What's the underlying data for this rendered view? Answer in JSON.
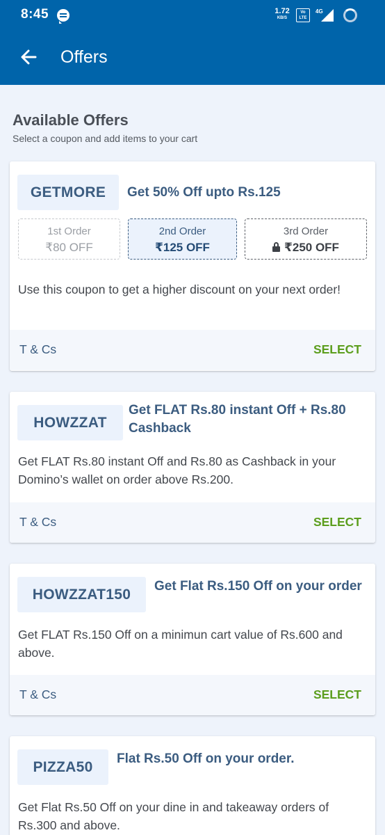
{
  "status_bar": {
    "time": "8:45",
    "speed_value": "1.72",
    "speed_unit": "KB/S",
    "volte_top": "Vo",
    "volte_bottom": "LTE",
    "network": "4G"
  },
  "app_bar": {
    "title": "Offers"
  },
  "section": {
    "title": "Available Offers",
    "subtitle": "Select a coupon and add items to your cart"
  },
  "offers": [
    {
      "code": "GETMORE",
      "title": "Get 50% Off upto Rs.125",
      "tiers": [
        {
          "label": "1st Order",
          "value": "₹80 OFF"
        },
        {
          "label": "2nd Order",
          "value": "₹125 OFF"
        },
        {
          "label": "3rd Order",
          "value": "₹250 OFF"
        }
      ],
      "description": "Use this coupon to get a higher discount on your next order!",
      "tcs_label": "T & Cs",
      "select_label": "SELECT"
    },
    {
      "code": "HOWZZAT",
      "title": "Get FLAT Rs.80 instant Off + Rs.80 Cashback",
      "description": "Get FLAT Rs.80 instant Off and Rs.80 as Cashback in your Domino’s wallet on order above Rs.200.",
      "tcs_label": "T & Cs",
      "select_label": "SELECT"
    },
    {
      "code": "HOWZZAT150",
      "title": "Get Flat Rs.150 Off on your order",
      "description": "Get FLAT Rs.150 Off on a minimun cart value of Rs.600 and above.",
      "tcs_label": "T & Cs",
      "select_label": "SELECT"
    },
    {
      "code": "PIZZA50",
      "title": "Flat Rs.50 Off on your order.",
      "description": "Get Flat Rs.50 Off on your dine in and takeaway orders of Rs.300 and above."
    }
  ],
  "colors": {
    "primary": "#0064aa",
    "background": "#eef3fb",
    "accent_text": "#3b5c80",
    "select_green": "#5c9e1e"
  },
  "icons": {
    "back": "arrow-left-icon",
    "lock": "lock-icon",
    "message": "message-icon"
  }
}
